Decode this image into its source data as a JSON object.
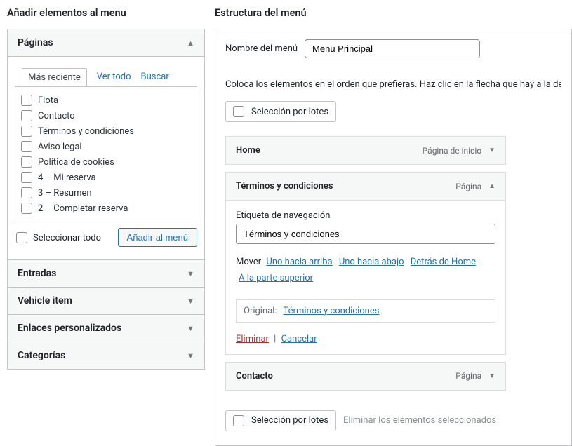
{
  "left": {
    "heading": "Añadir elementos al menu",
    "panels": {
      "pages": "Páginas",
      "entries": "Entradas",
      "vehicle": "Vehicle item",
      "custom_links": "Enlaces personalizados",
      "categories": "Categorías"
    },
    "tabs": {
      "recent": "Más reciente",
      "view_all": "Ver todo",
      "search": "Buscar"
    },
    "pages_list": [
      "Flota",
      "Contacto",
      "Términos y condiciones",
      "Aviso legal",
      "Política de cookies",
      "4 – Mi reserva",
      "3 – Resumen",
      "2 – Completar reserva"
    ],
    "select_all": "Seleccionar todo",
    "add_button": "Añadir al menú"
  },
  "right": {
    "heading": "Estructura del menú",
    "menu_name_label": "Nombre del menú",
    "menu_name_value": "Menu Principal",
    "hint": "Coloca los elementos en el orden que prefieras. Haz clic en la flecha que hay a la dere",
    "bulk_select": "Selección por lotes",
    "delete_selected": "Eliminar los elementos seleccionados",
    "items": {
      "home": {
        "title": "Home",
        "type": "Página de inicio"
      },
      "terms": {
        "title": "Términos y condiciones",
        "type": "Página"
      },
      "contact": {
        "title": "Contacto",
        "type": "Página"
      }
    },
    "edit": {
      "nav_label": "Etiqueta de navegación",
      "nav_value": "Términos y condiciones",
      "move": "Mover",
      "move_up": "Uno hacia arriba",
      "move_down": "Uno hacia abajo",
      "move_behind": "Detrás de Home",
      "move_top": "A la parte superior",
      "original_label": "Original:",
      "original_link": "Términos y condiciones",
      "delete": "Eliminar",
      "cancel": "Cancelar"
    }
  }
}
